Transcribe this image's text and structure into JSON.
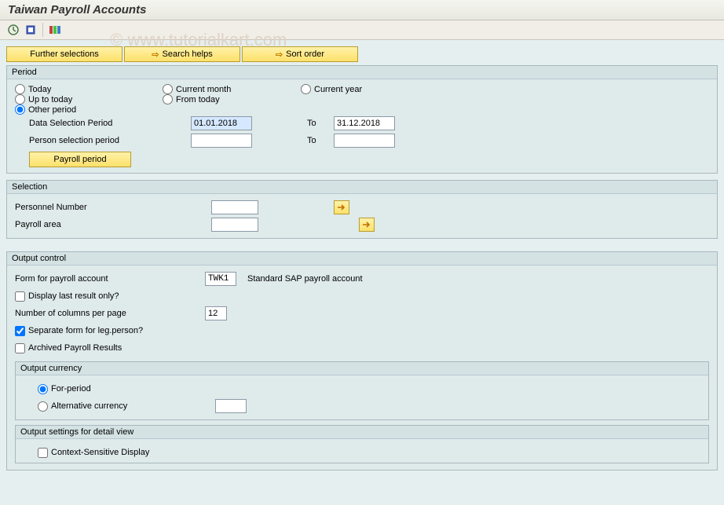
{
  "title": "Taiwan Payroll Accounts",
  "watermark": "© www.tutorialkart.com",
  "buttons": {
    "further": "Further selections",
    "search": "Search helps",
    "sort": "Sort order",
    "payroll_period": "Payroll period"
  },
  "period": {
    "title": "Period",
    "today": "Today",
    "current_month": "Current month",
    "current_year": "Current year",
    "up_to_today": "Up to today",
    "from_today": "From today",
    "other_period": "Other period",
    "data_sel_label": "Data Selection Period",
    "data_sel_from": "01.01.2018",
    "to": "To",
    "data_sel_to": "31.12.2018",
    "person_sel_label": "Person selection period",
    "person_sel_from": "",
    "person_sel_to": ""
  },
  "selection": {
    "title": "Selection",
    "pernr_label": "Personnel Number",
    "pernr_val": "",
    "payroll_area_label": "Payroll area",
    "payroll_area_val": ""
  },
  "output": {
    "title": "Output control",
    "form_label": "Form for payroll account",
    "form_val": "TWK1",
    "form_desc": "Standard SAP payroll account",
    "display_last": "Display last result only?",
    "cols_label": "Number of columns per page",
    "cols_val": "12",
    "sep_form": "Separate form for leg.person?",
    "archived": "Archived Payroll Results",
    "currency": {
      "title": "Output currency",
      "for_period": "For-period",
      "alt": "Alternative currency",
      "alt_val": ""
    },
    "detail": {
      "title": "Output settings for detail view",
      "context": "Context-Sensitive Display"
    }
  }
}
